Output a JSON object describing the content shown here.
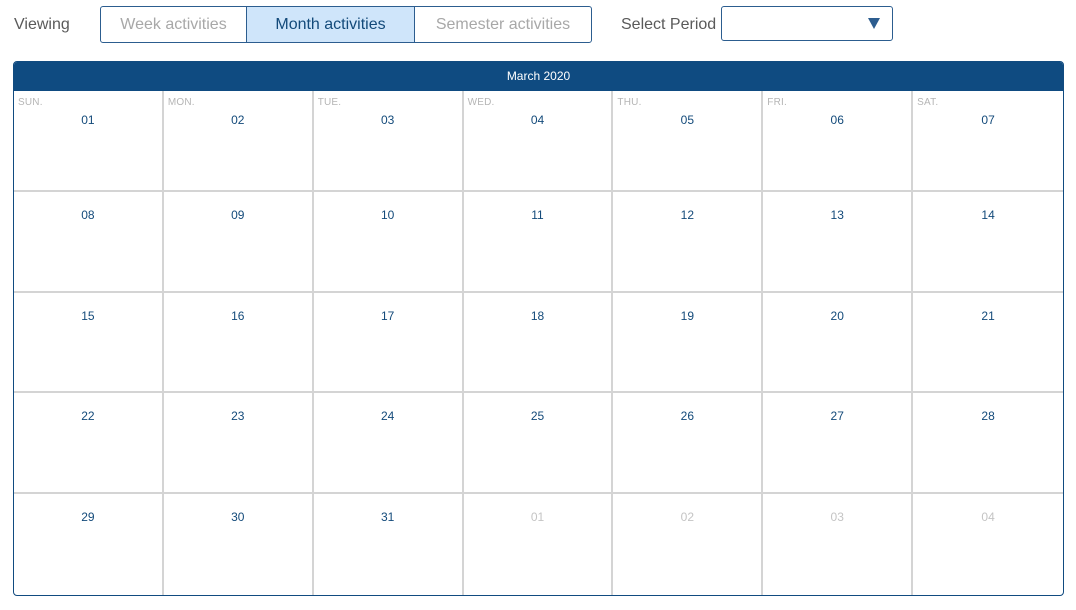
{
  "toolbar": {
    "viewing_label": "Viewing",
    "tabs": [
      {
        "label": "Week activities",
        "active": false
      },
      {
        "label": "Month activities",
        "active": true
      },
      {
        "label": "Semester activities",
        "active": false
      }
    ],
    "period_label": "Select Period",
    "period_value": "",
    "period_caret_icon": "triangle-down-icon"
  },
  "calendar": {
    "title": "March 2020",
    "weekdays": [
      "SUN.",
      "MON.",
      "TUE.",
      "WED.",
      "THU.",
      "FRI.",
      "SAT."
    ],
    "weeks": [
      [
        {
          "day": "01",
          "current": true
        },
        {
          "day": "02",
          "current": true
        },
        {
          "day": "03",
          "current": true
        },
        {
          "day": "04",
          "current": true
        },
        {
          "day": "05",
          "current": true
        },
        {
          "day": "06",
          "current": true
        },
        {
          "day": "07",
          "current": true
        }
      ],
      [
        {
          "day": "08",
          "current": true
        },
        {
          "day": "09",
          "current": true
        },
        {
          "day": "10",
          "current": true
        },
        {
          "day": "11",
          "current": true
        },
        {
          "day": "12",
          "current": true
        },
        {
          "day": "13",
          "current": true
        },
        {
          "day": "14",
          "current": true
        }
      ],
      [
        {
          "day": "15",
          "current": true
        },
        {
          "day": "16",
          "current": true
        },
        {
          "day": "17",
          "current": true
        },
        {
          "day": "18",
          "current": true
        },
        {
          "day": "19",
          "current": true
        },
        {
          "day": "20",
          "current": true
        },
        {
          "day": "21",
          "current": true
        }
      ],
      [
        {
          "day": "22",
          "current": true
        },
        {
          "day": "23",
          "current": true
        },
        {
          "day": "24",
          "current": true
        },
        {
          "day": "25",
          "current": true
        },
        {
          "day": "26",
          "current": true
        },
        {
          "day": "27",
          "current": true
        },
        {
          "day": "28",
          "current": true
        }
      ],
      [
        {
          "day": "29",
          "current": true
        },
        {
          "day": "30",
          "current": true
        },
        {
          "day": "31",
          "current": true
        },
        {
          "day": "01",
          "current": false
        },
        {
          "day": "02",
          "current": false
        },
        {
          "day": "03",
          "current": false
        },
        {
          "day": "04",
          "current": false
        }
      ]
    ]
  },
  "colors": {
    "accent": "#0f4b81",
    "active_tab_bg": "#cfe5fa",
    "border": "#2c5d8f",
    "day_text": "#134a7a",
    "muted_day_text": "#c4c4c4"
  }
}
